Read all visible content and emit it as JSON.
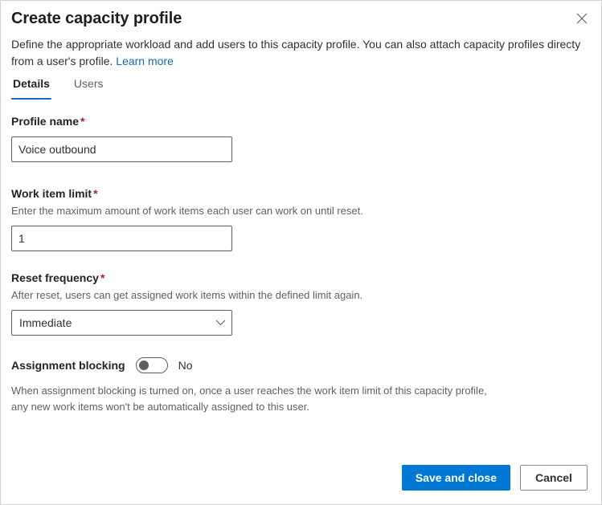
{
  "header": {
    "title": "Create capacity profile",
    "subtitle_text": "Define the appropriate workload and add users to this capacity profile. You can also attach capacity profiles directy from a user's profile. ",
    "learn_more_label": "Learn more",
    "close_icon": "close-icon"
  },
  "tabs": [
    {
      "label": "Details",
      "selected": true
    },
    {
      "label": "Users",
      "selected": false
    }
  ],
  "form": {
    "required_marker": "*",
    "profile_name": {
      "label": "Profile name",
      "value": "Voice outbound",
      "placeholder": "Profile name"
    },
    "work_item_limit": {
      "label": "Work item limit",
      "hint": "Enter the maximum amount of work items each user can work on until reset.",
      "value": "1",
      "placeholder": "Work item limit"
    },
    "reset_frequency": {
      "label": "Reset frequency",
      "hint": "After reset, users can get assigned work items within the defined limit again.",
      "selected": "Immediate",
      "options": [
        "Immediate"
      ],
      "chevron_icon": "chevron-down-icon"
    },
    "assignment_blocking": {
      "label": "Assignment blocking",
      "state_label": "No",
      "checked": false,
      "description": "When assignment blocking is turned on, once a user reaches the work item limit of this capacity profile, any new work items won't be automatically assigned to this user."
    }
  },
  "footer": {
    "save_label": "Save and close",
    "cancel_label": "Cancel"
  },
  "colors": {
    "accent": "#0078d4",
    "tab_underline": "#0f6cbd",
    "link": "#0f6cbd",
    "required": "#a4262c",
    "border": "#605e5c",
    "panel_border": "#d1d1d1"
  }
}
